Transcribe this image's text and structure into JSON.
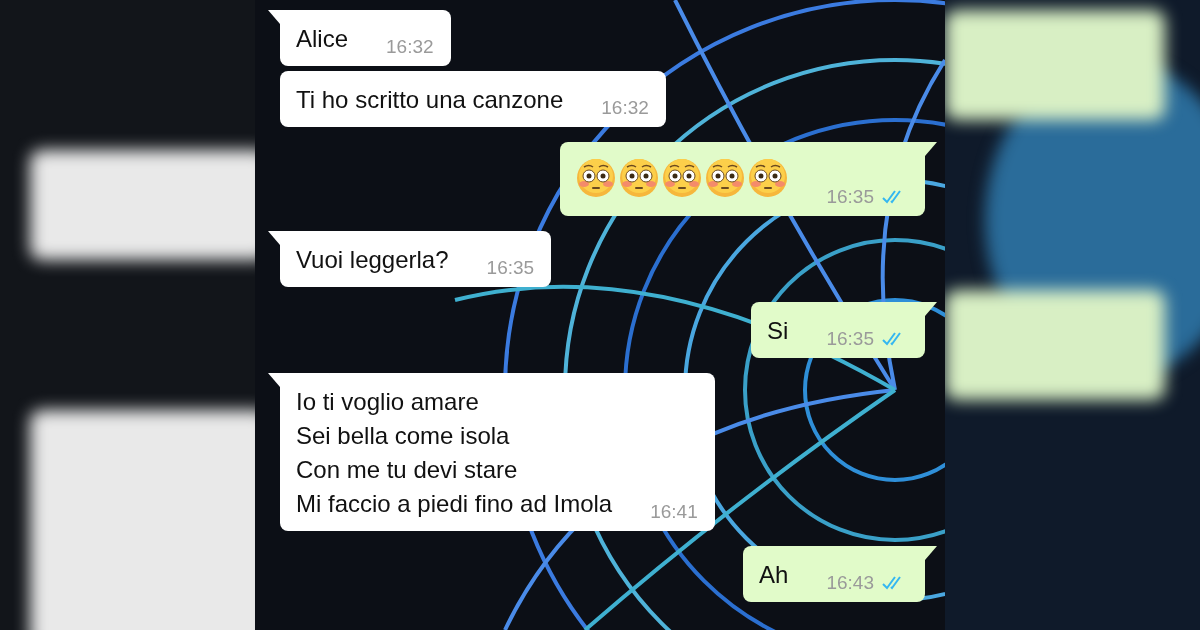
{
  "messages": [
    {
      "kind": "text",
      "outgoing": false,
      "text": "Alice",
      "time": "16:32",
      "first": true
    },
    {
      "kind": "text",
      "outgoing": false,
      "text": "Ti ho scritto una canzone",
      "time": "16:32",
      "first": false
    },
    {
      "kind": "emoji",
      "outgoing": true,
      "emoji": [
        {
          "kind": "flushed-face"
        },
        {
          "kind": "flushed-face"
        },
        {
          "kind": "flushed-face"
        },
        {
          "kind": "flushed-face"
        },
        {
          "kind": "flushed-face"
        }
      ],
      "time": "16:35",
      "first": true,
      "read": true
    },
    {
      "kind": "text",
      "outgoing": false,
      "text": "Vuoi leggerla?",
      "time": "16:35",
      "first": true
    },
    {
      "kind": "text",
      "outgoing": true,
      "text": "Si",
      "time": "16:35",
      "first": true,
      "read": true
    },
    {
      "kind": "text",
      "outgoing": false,
      "text": "Io ti voglio amare\nSei bella come isola\nCon me tu devi stare\nMi faccio a piedi fino ad Imola",
      "time": "16:41",
      "first": true
    },
    {
      "kind": "text",
      "outgoing": true,
      "text": "Ah",
      "time": "16:43",
      "first": true,
      "read": true
    }
  ]
}
